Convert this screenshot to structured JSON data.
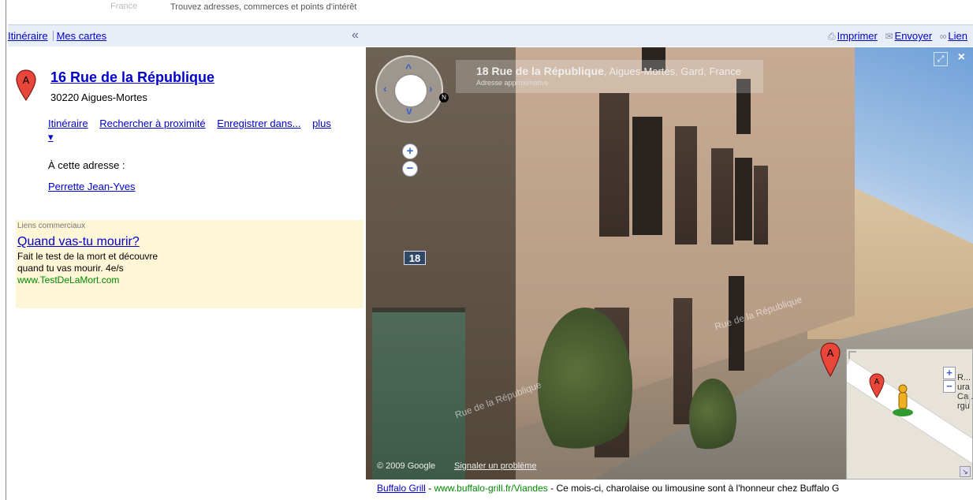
{
  "header": {
    "tagline": "Trouvez adresses, commerces et points d'intérêt",
    "faint_label": "France"
  },
  "toolbar": {
    "left_links": [
      "Itinéraire",
      "Mes cartes"
    ],
    "collapse_symbol": "«",
    "right_links": [
      {
        "label": "Imprimer",
        "icon": "printer-icon"
      },
      {
        "label": "Envoyer",
        "icon": "envelope-icon"
      },
      {
        "label": "Lien",
        "icon": "link-icon"
      }
    ]
  },
  "result": {
    "marker_letter": "A",
    "title": "16 Rue de la République",
    "address": "30220 Aigues-Mortes",
    "actions": {
      "itineraire": "Itinéraire",
      "rechercher": "Rechercher à proximité",
      "enregistrer": "Enregistrer dans...",
      "plus": "plus ▾"
    },
    "at_address_label": "À cette adresse :",
    "person_link": "Perrette Jean-Yves"
  },
  "ad": {
    "label": "Liens commerciaux",
    "title": "Quand vas-tu mourir?",
    "text_line1": "Fait le test de la mort et découvre",
    "text_line2": "quand tu vas mourir. 4e/s",
    "url": "www.TestDeLaMort.com"
  },
  "streetview": {
    "info_title_bold": "18 Rue de la République",
    "info_title_rest": ", Aigues-Mortes, Gard, France",
    "info_sub": "Adresse approximative",
    "house_number": "18",
    "street_label_1": "Rue de la République",
    "street_label_2": "Rue de la République",
    "copyright": "© 2009 Google",
    "report_link": "Signaler un problème",
    "compass_letter": "N",
    "minimap_text": [
      "R... ura",
      "Ca... rgu"
    ],
    "minimap_pin_letter": "A",
    "pin_letter": "A"
  },
  "bottom_ad": {
    "title": "Buffalo Grill",
    "url": "www.buffalo-grill.fr/Viandes",
    "text": "Ce mois-ci, charolaise ou limousine sont à l'honneur chez Buffalo G"
  },
  "colors": {
    "link": "#0000cc",
    "ad_background": "#fff6d8",
    "ad_url": "#008000",
    "toolbar_bg": "#e8eef7",
    "marker_red": "#e8463a"
  }
}
